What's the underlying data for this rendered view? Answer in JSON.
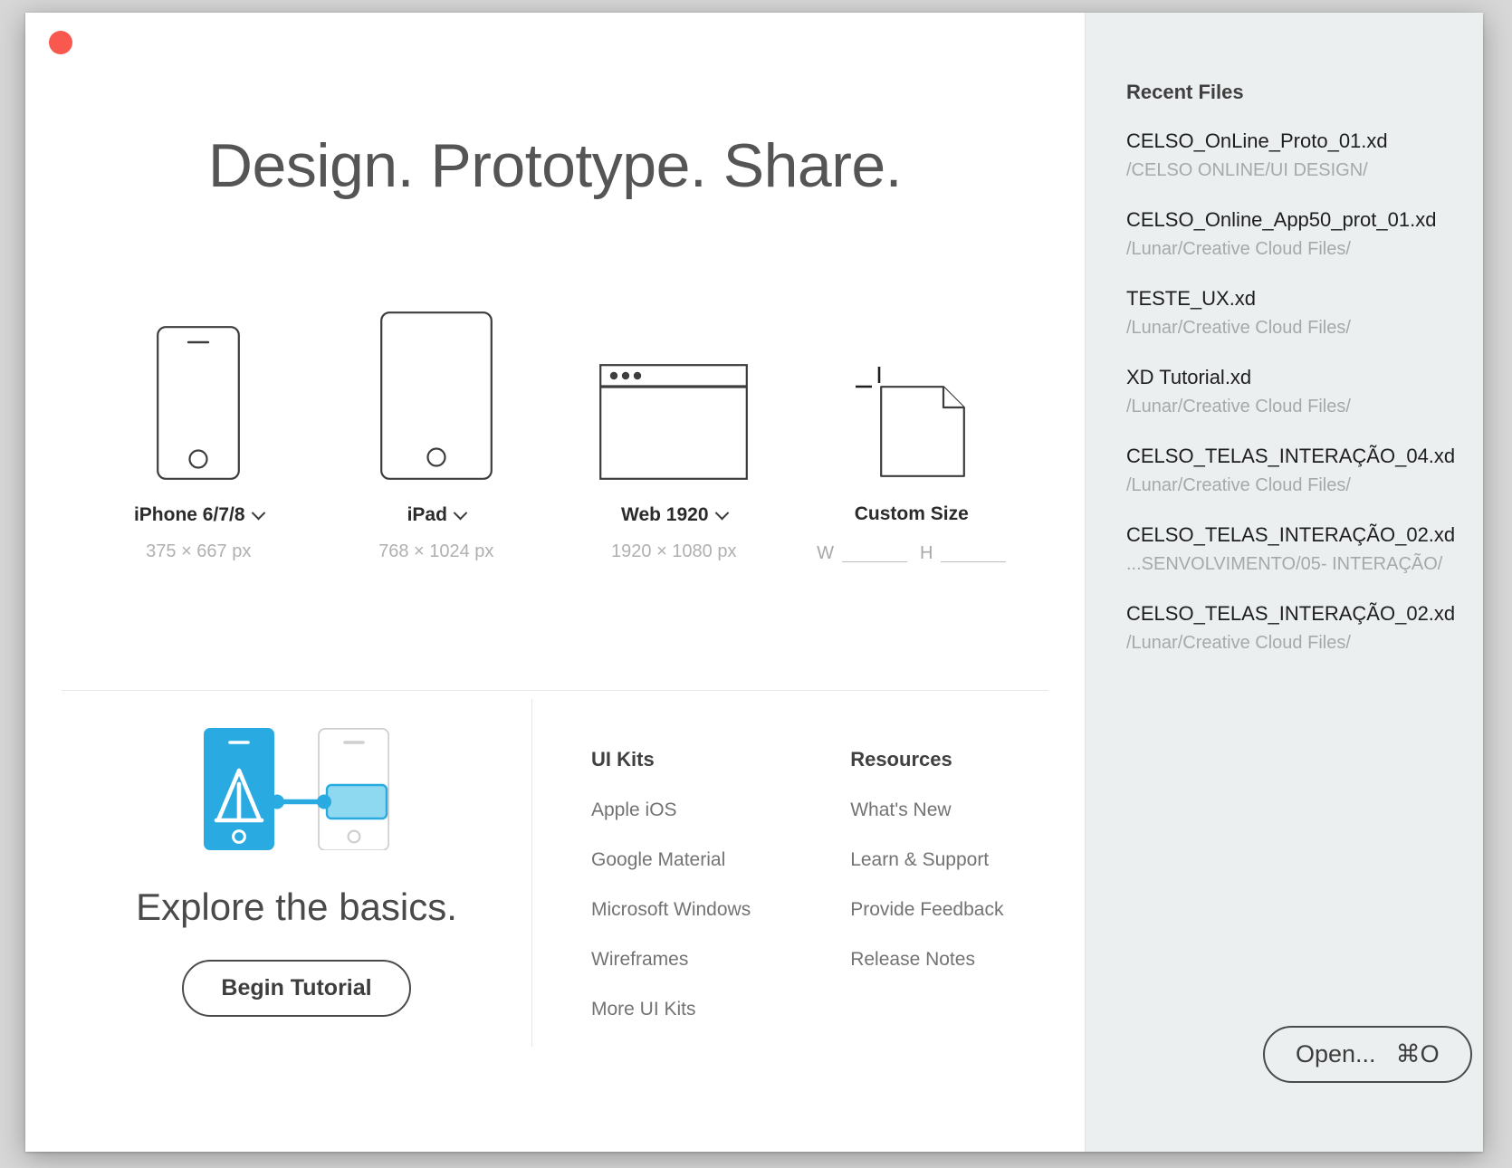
{
  "window": {
    "close_label": "close"
  },
  "hero": {
    "title": "Design. Prototype. Share."
  },
  "presets": [
    {
      "name": "iPhone 6/7/8",
      "dims": "375 × 667 px",
      "icon": "phone-icon",
      "has_chevron": true
    },
    {
      "name": "iPad",
      "dims": "768 × 1024 px",
      "icon": "tablet-icon",
      "has_chevron": true
    },
    {
      "name": "Web 1920",
      "dims": "1920 × 1080 px",
      "icon": "browser-window-icon",
      "has_chevron": true
    },
    {
      "name": "Custom Size",
      "icon": "custom-document-icon",
      "has_chevron": false,
      "width_label": "W",
      "width_value": "",
      "height_label": "H",
      "height_value": ""
    }
  ],
  "tutorial": {
    "icon": "prototype-link-icon",
    "heading": "Explore the basics.",
    "button_label": "Begin Tutorial"
  },
  "link_columns": [
    {
      "title": "UI Kits",
      "items": [
        "Apple iOS",
        "Google Material",
        "Microsoft Windows",
        "Wireframes",
        "More UI Kits"
      ]
    },
    {
      "title": "Resources",
      "items": [
        "What's New",
        "Learn & Support",
        "Provide Feedback",
        "Release Notes"
      ]
    }
  ],
  "recent": {
    "title": "Recent Files",
    "files": [
      {
        "name": "CELSO_OnLine_Proto_01.xd",
        "path": "/CELSO ONLINE/UI DESIGN/"
      },
      {
        "name": "CELSO_Online_App50_prot_01.xd",
        "path": "/Lunar/Creative Cloud Files/"
      },
      {
        "name": "TESTE_UX.xd",
        "path": "/Lunar/Creative Cloud Files/"
      },
      {
        "name": "XD Tutorial.xd",
        "path": "/Lunar/Creative Cloud Files/"
      },
      {
        "name": "CELSO_TELAS_INTERAÇÃO_04.xd",
        "path": "/Lunar/Creative Cloud Files/"
      },
      {
        "name": "CELSO_TELAS_INTERAÇÃO_02.xd",
        "path": "...SENVOLVIMENTO/05- INTERAÇÃO/"
      },
      {
        "name": "CELSO_TELAS_INTERAÇÃO_02.xd",
        "path": "/Lunar/Creative Cloud Files/"
      }
    ],
    "open_label": "Open...",
    "open_shortcut": "⌘O"
  },
  "colors": {
    "accent_blue": "#29abe2",
    "accent_blue_light": "#8ed8f0",
    "close_red": "#f9584f",
    "panel_bg": "#eceff0",
    "text_dark": "#2b2b2b",
    "text_muted": "#a6a9aa"
  }
}
